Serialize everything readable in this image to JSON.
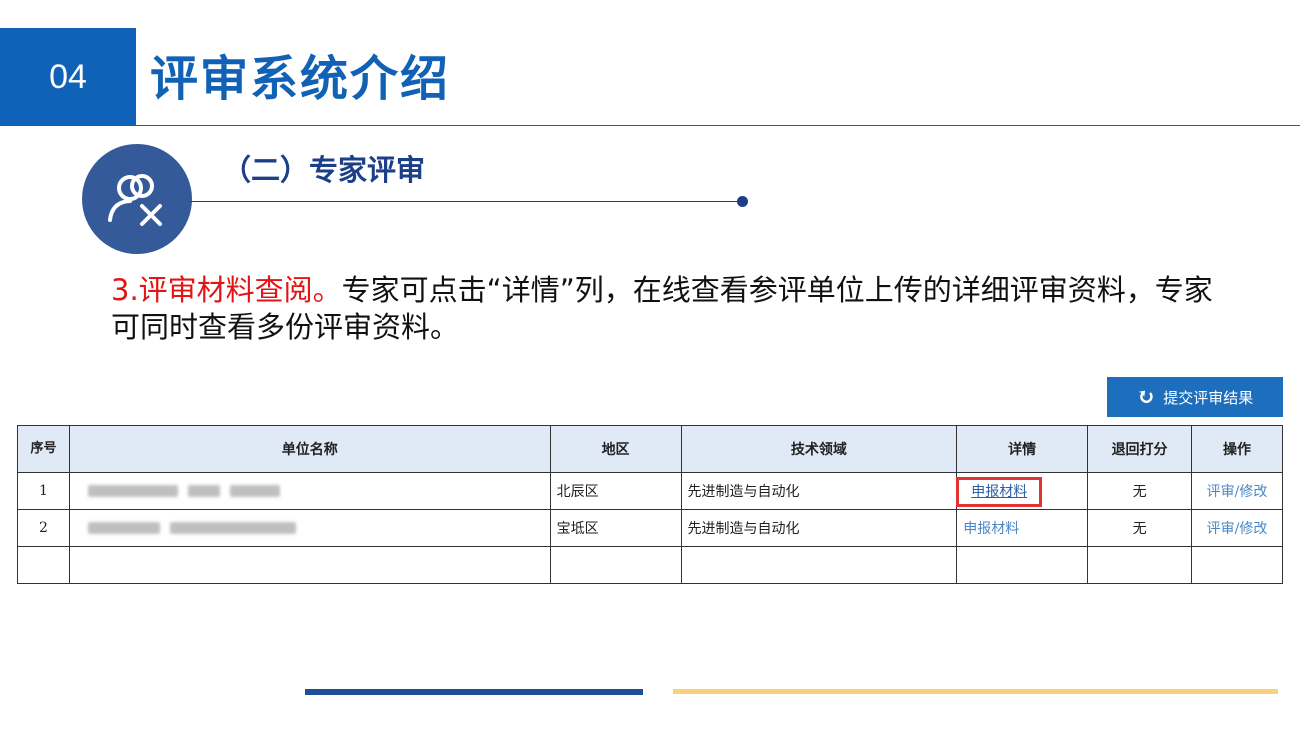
{
  "header": {
    "section_number": "04",
    "title": "评审系统介绍"
  },
  "section": {
    "subtitle": "（二）专家评审",
    "icon": "user-tools-icon"
  },
  "description": {
    "highlight": "3.评审材料查阅。",
    "text": "专家可点击“详情”列，在线查看参评单位上传的详细评审资料，专家可同时查看多份评审资料。"
  },
  "toolbar": {
    "submit_label": "提交评审结果",
    "submit_icon": "refresh-icon"
  },
  "table": {
    "headers": [
      "序号",
      "单位名称",
      "地区",
      "技术领域",
      "详情",
      "退回打分",
      "操作"
    ],
    "rows": [
      {
        "index": "1",
        "region": "北辰区",
        "field": "先进制造与自动化",
        "detail": "申报材料",
        "returned": "无",
        "action": "评审/修改"
      },
      {
        "index": "2",
        "region": "宝坻区",
        "field": "先进制造与自动化",
        "detail": "申报材料",
        "returned": "无",
        "action": "评审/修改"
      }
    ]
  },
  "colors": {
    "brand_blue": "#1061b8",
    "navy": "#1c3f87",
    "highlight_red": "#e31414",
    "accent_yellow": "#f7d27a"
  }
}
